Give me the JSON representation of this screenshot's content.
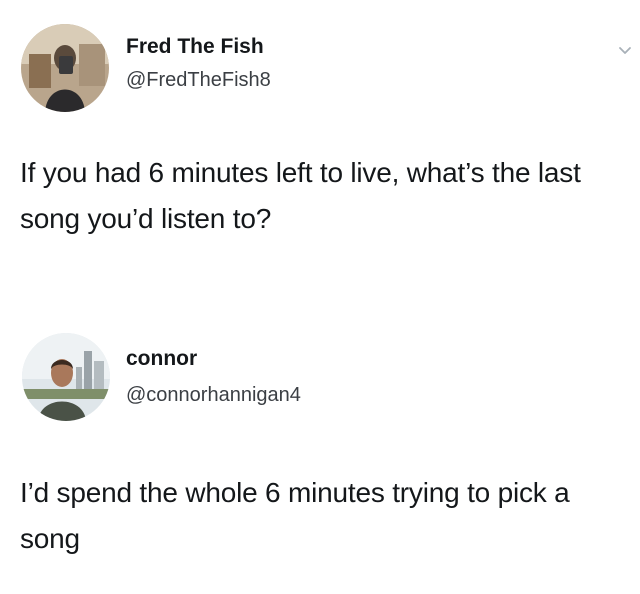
{
  "tweets": [
    {
      "author": {
        "display_name": "Fred The Fish",
        "handle": "@FredTheFish8",
        "avatar_icon": "user-avatar-photo"
      },
      "text": "If you had 6 minutes left to live, what’s the last song you’d listen to?",
      "menu_icon": "chevron-down-icon"
    },
    {
      "author": {
        "display_name": "connor",
        "handle": "@connorhannigan4",
        "avatar_icon": "user-avatar-photo"
      },
      "text": "I’d spend the whole 6 minutes trying to pick a song"
    }
  ],
  "colors": {
    "background": "#ffffff",
    "text": "#14171a",
    "handle": "#3b3f44"
  }
}
